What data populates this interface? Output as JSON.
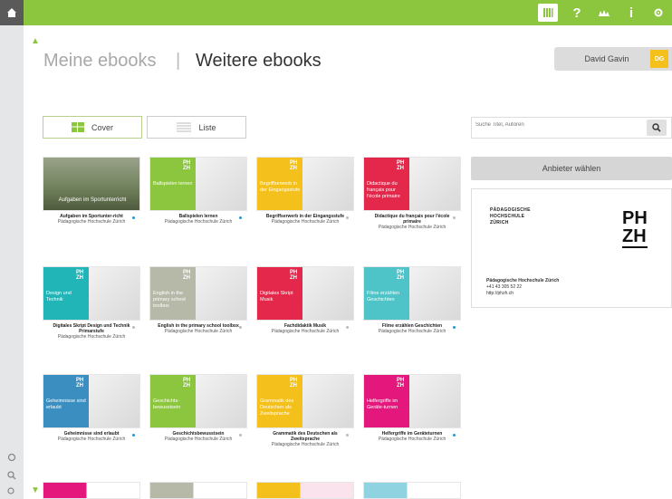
{
  "header": {
    "tab_mine": "Meine ebooks",
    "separator": "|",
    "tab_more": "Weitere ebooks",
    "user_name": "David Gavin",
    "user_initials": "DG"
  },
  "toolbar": {
    "help": "?",
    "info": "i"
  },
  "view": {
    "cover_label": "Cover",
    "list_label": "Liste"
  },
  "search": {
    "placeholder": "Suche Titel, Autoren"
  },
  "provider": {
    "button_label": "Anbieter wählen",
    "name_lines": [
      "PÄDAGOGISCHE",
      "HOCHSCHULE",
      "ZÜRICH"
    ],
    "logo_top": "PH",
    "logo_bottom": "ZH",
    "address_name": "Pädagogische Hochschule Zürich",
    "phone": "+41 43 305 52 22",
    "url": "http://phzh.ch"
  },
  "books": [
    {
      "title": "Aufgaben im Sportunter-richt",
      "publisher": "Pädagogische Hochschule Zürich",
      "cover_text": "Aufgaben im Sportunterricht",
      "color": "#6f7f5a",
      "status": "blue"
    },
    {
      "title": "Ballspielen lernen",
      "publisher": "Pädagogische Hochschule Zürich",
      "cover_text": "Ballspielen lernen",
      "color": "#8cc63f",
      "status": "blue"
    },
    {
      "title": "Begriffserwerb in der Eingangsstufe",
      "publisher": "Pädagogische Hochschule Zürich",
      "cover_text": "Begriffserwerb in der Eingangsstufe",
      "color": "#f3c01c",
      "status": "grey"
    },
    {
      "title": "Didactique du français pour l'école primaire",
      "publisher": "Pädagogische Hochschule Zürich",
      "cover_text": "Didactique du français pour l'école primaire",
      "color": "#e4284b",
      "status": "grey"
    },
    {
      "title": "Digitales Skript Design und Technik Primarstufe",
      "publisher": "Pädagogische Hochschule Zürich",
      "cover_text": "Design und Technik",
      "color": "#21b5b8",
      "status": "grey"
    },
    {
      "title": "English in the primary school toolbox",
      "publisher": "Pädagogische Hochschule Zürich",
      "cover_text": "English in the primary school toolbox",
      "color": "#b7b9a8",
      "status": "grey"
    },
    {
      "title": "Fachdidaktik Musik",
      "publisher": "Pädagogische Hochschule Zürich",
      "cover_text": "Digitales Skript Musik",
      "color": "#e4284b",
      "status": "grey"
    },
    {
      "title": "Filme erzählen Geschichten",
      "publisher": "Pädagogische Hochschule Zürich",
      "cover_text": "Filme erzählen Geschichten",
      "color": "#4ec3c8",
      "status": "blue"
    },
    {
      "title": "Geheimnisse sind erlaubt",
      "publisher": "Pädagogische Hochschule Zürich",
      "cover_text": "Geheimnisse sind erlaubt",
      "color": "#3b8fc0",
      "status": "blue"
    },
    {
      "title": "Geschichtsbewusstsein",
      "publisher": "Pädagogische Hochschule Zürich",
      "cover_text": "Geschichts-bewusstsein",
      "color": "#8cc63f",
      "status": "grey"
    },
    {
      "title": "Grammatik des Deutschen als Zweitsprache",
      "publisher": "Pädagogische Hochschule Zürich",
      "cover_text": "Grammatik des Deutschen als Zweitsprache",
      "color": "#f3c01c",
      "status": "grey"
    },
    {
      "title": "Helfergriffe im Geräteturnen",
      "publisher": "Pädagogische Hochschule Zürich",
      "cover_text": "Helfergriffe im Geräte-turnen",
      "color": "#e4187c",
      "status": "blue"
    }
  ],
  "ph_mini": "PH ZH"
}
